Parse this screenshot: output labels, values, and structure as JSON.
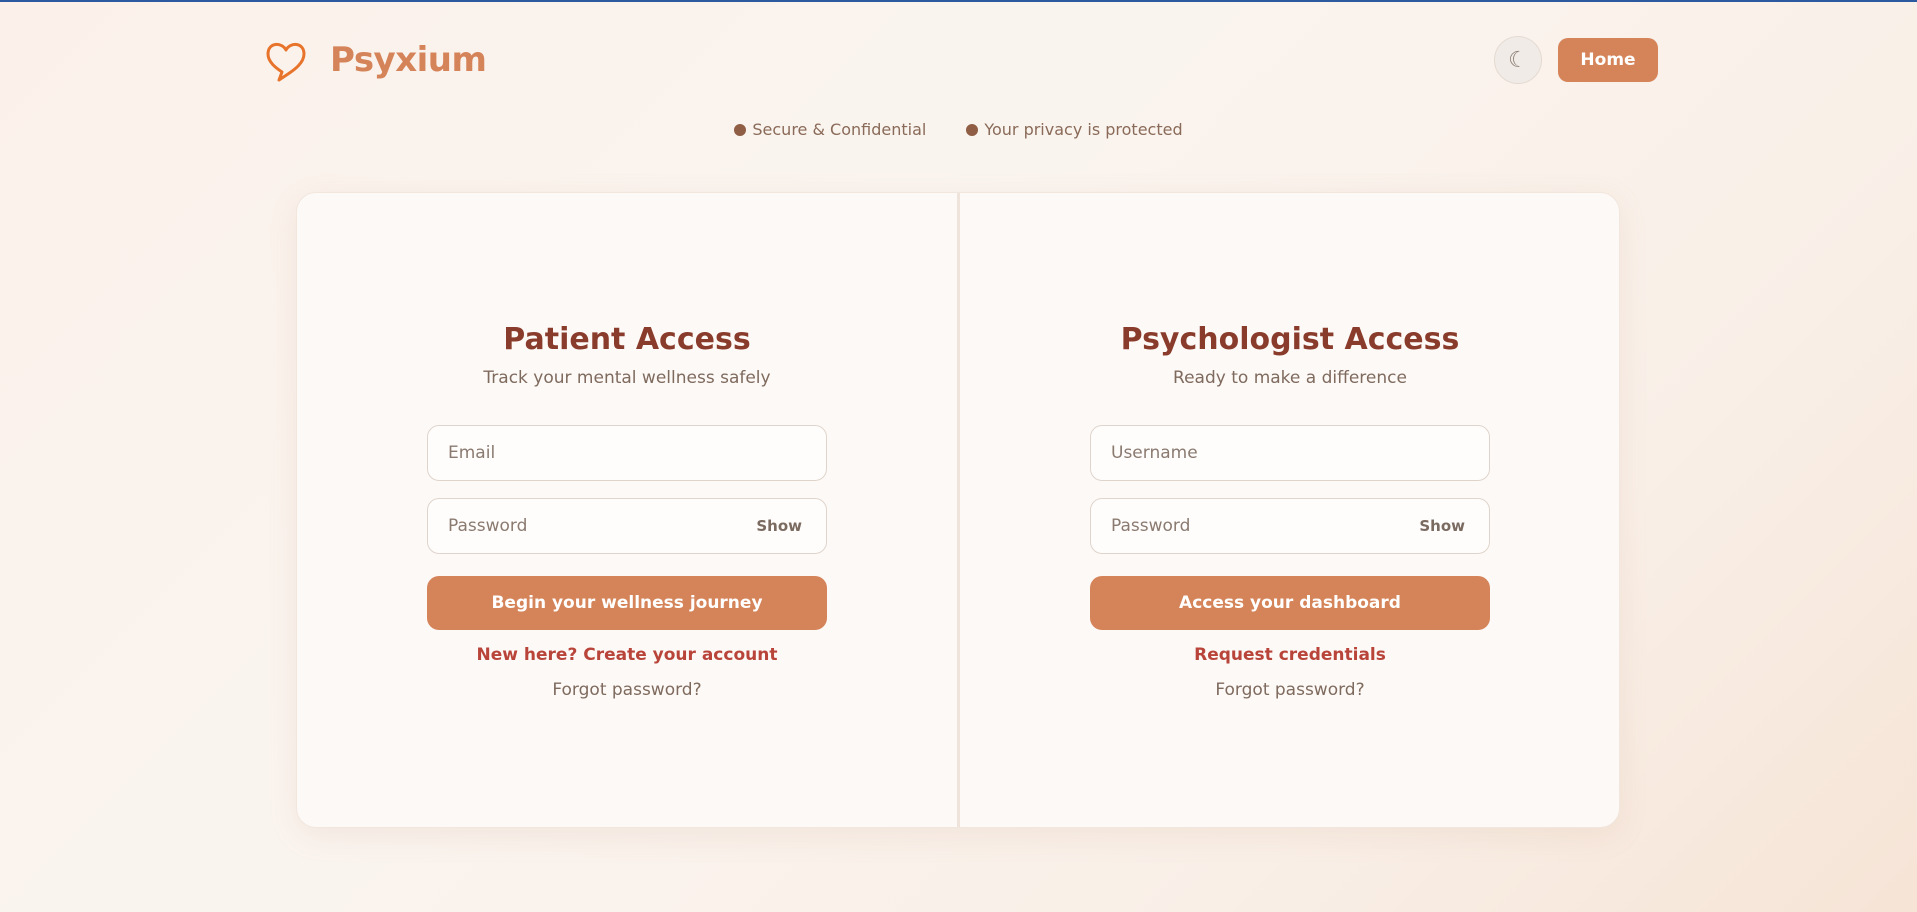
{
  "brand": {
    "name": "Psyxium",
    "icon": "heart-chat-icon",
    "accent_color": "#d58358"
  },
  "header": {
    "theme_toggle_glyph": "☾",
    "home_label": "Home"
  },
  "trust": {
    "items": [
      "Secure & Confidential",
      "Your privacy is protected"
    ]
  },
  "patient": {
    "title": "Patient Access",
    "subtitle": "Track your mental wellness safely",
    "email_placeholder": "Email",
    "password_placeholder": "Password",
    "show_label": "Show",
    "submit_label": "Begin your wellness journey",
    "signup_link": "New here? Create your account",
    "forgot_link": "Forgot password?"
  },
  "psychologist": {
    "title": "Psychologist Access",
    "subtitle": "Ready to make a difference",
    "username_placeholder": "Username",
    "password_placeholder": "Password",
    "show_label": "Show",
    "submit_label": "Access your dashboard",
    "request_link": "Request credentials",
    "forgot_link": "Forgot password?"
  }
}
